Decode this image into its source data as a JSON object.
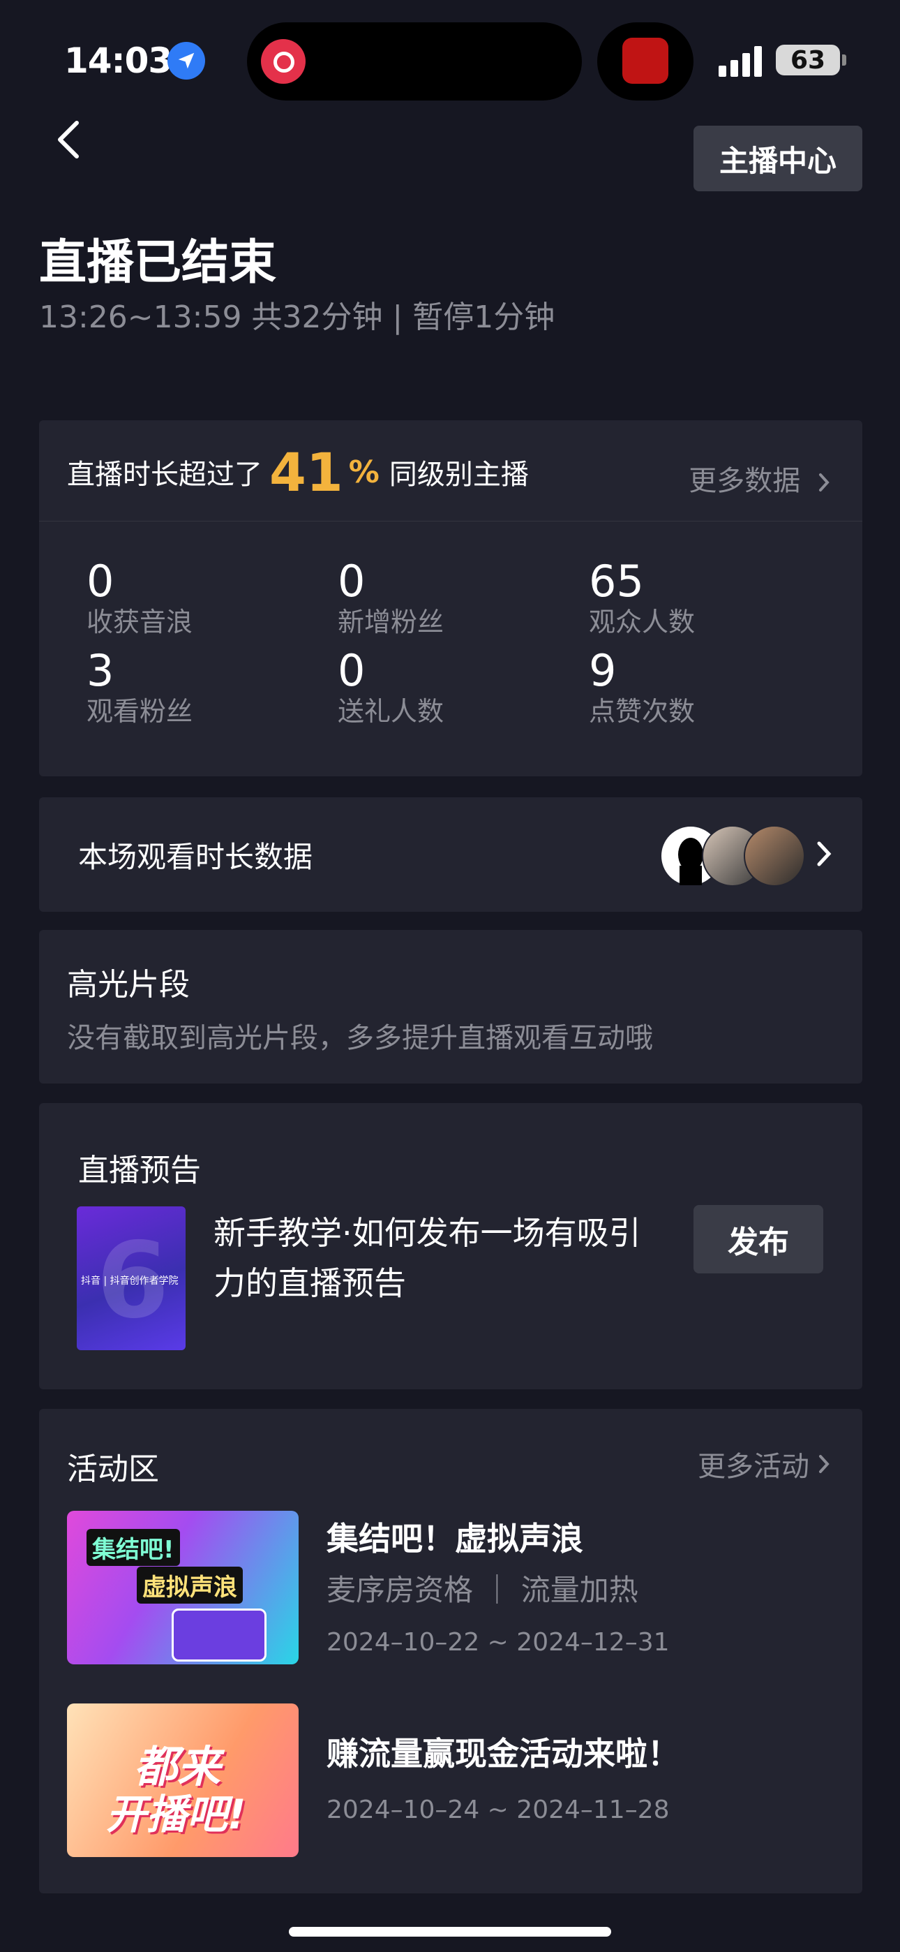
{
  "status_bar": {
    "time": "14:03",
    "battery": "63"
  },
  "header": {
    "back_label": "<",
    "anchor_center_label": "主播中心",
    "title": "直播已结束",
    "subtitle": "13:26~13:59 共32分钟 | 暂停1分钟"
  },
  "stats": {
    "prefix": "直播时长超过了",
    "percent": "41",
    "percent_sign": "%",
    "suffix": "同级别主播",
    "more_label": "更多数据",
    "items": [
      {
        "value": "0",
        "label": "收获音浪"
      },
      {
        "value": "0",
        "label": "新增粉丝"
      },
      {
        "value": "65",
        "label": "观众人数"
      },
      {
        "value": "3",
        "label": "观看粉丝"
      },
      {
        "value": "0",
        "label": "送礼人数"
      },
      {
        "value": "9",
        "label": "点赞次数"
      }
    ]
  },
  "watch": {
    "title": "本场观看时长数据"
  },
  "highlight": {
    "title": "高光片段",
    "desc": "没有截取到高光片段，多多提升直播观看互动哦"
  },
  "preview": {
    "title": "直播预告",
    "thumb_label": "抖音 | 抖音创作者学院",
    "text": "新手教学·如何发布一场有吸引力的直播预告",
    "publish_label": "发布"
  },
  "activity": {
    "title": "活动区",
    "more_label": "更多活动",
    "items": [
      {
        "title": "集结吧！虚拟声浪",
        "tags": "麦序房资格 ｜ 流量加热",
        "date": "2024–10–22 ~ 2024–12–31",
        "thumb_text_1": "集结吧!",
        "thumb_text_2": "虚拟声浪"
      },
      {
        "title": "赚流量赢现金活动来啦！",
        "date": "2024–10–24 ~ 2024–11–28",
        "thumb_text_1": "都来",
        "thumb_text_2": "开播吧!"
      }
    ]
  }
}
